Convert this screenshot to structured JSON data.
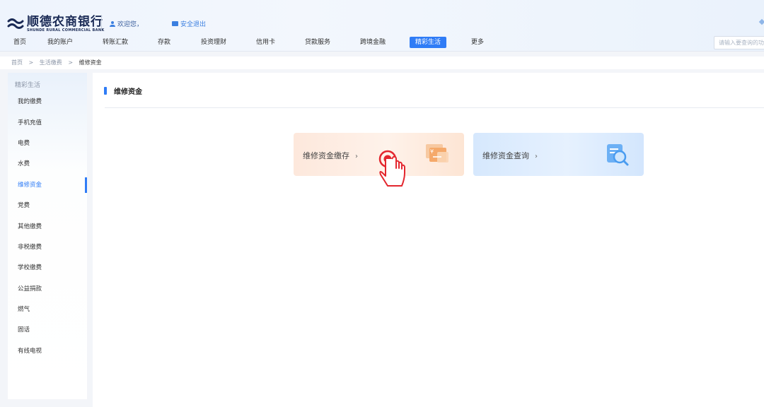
{
  "header": {
    "logo_cn": "顺德农商银行",
    "logo_en": "SHUNDE RURAL COMMERCIAL BANK",
    "welcome": "欢迎您，",
    "logout": "安全退出"
  },
  "nav": {
    "items": [
      "首页",
      "我的账户",
      "转账汇款",
      "存款",
      "投资理财",
      "信用卡",
      "贷款服务",
      "跨境金融",
      "精彩生活",
      "更多"
    ],
    "active": "精彩生活"
  },
  "search": {
    "placeholder": "请输入要查询的功能"
  },
  "breadcrumb": {
    "items": [
      "首页",
      ">",
      "生活缴费",
      ">",
      "维修资金"
    ]
  },
  "sidebar": {
    "title": "精彩生活",
    "items": [
      "我的缴费",
      "手机充值",
      "电费",
      "水费",
      "维修资金",
      "党费",
      "其他缴费",
      "非税缴费",
      "学校缴费",
      "公益捐款",
      "燃气",
      "固话",
      "有线电视"
    ],
    "active": "维修资金"
  },
  "main": {
    "title": "维修资金",
    "cards": [
      {
        "label": "维修资金缴存",
        "arrow": "›",
        "icon": "yuan-card-icon"
      },
      {
        "label": "维修资金查询",
        "arrow": "›",
        "icon": "document-search-icon"
      }
    ]
  },
  "colors": {
    "accent": "#2f7cf6",
    "cursor": "#e3262e",
    "deposit_card": "#fde8dc",
    "query_card": "#d6e8fd"
  }
}
